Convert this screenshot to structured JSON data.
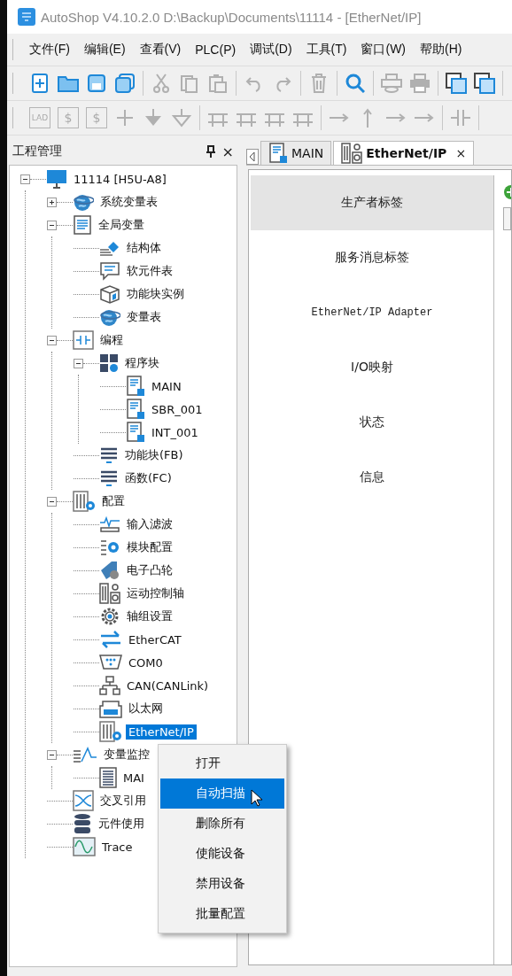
{
  "window": {
    "title": "AutoShop V4.10.2.0  D:\\Backup\\Documents\\11114 - [EtherNet/IP]"
  },
  "menu_bar": [
    "文件(F)",
    "编辑(E)",
    "查看(V)",
    "PLC(P)",
    "调试(D)",
    "工具(T)",
    "窗口(W)",
    "帮助(H)"
  ],
  "toolbar_1": [
    [
      {
        "disabled": false
      },
      {
        "disabled": false
      },
      {
        "disabled": false
      },
      {
        "disabled": false
      }
    ],
    [
      {
        "disabled": true
      },
      {
        "disabled": true
      },
      {
        "disabled": true
      }
    ],
    [
      {
        "disabled": true
      },
      {
        "disabled": true
      }
    ],
    [
      {
        "disabled": true
      }
    ],
    [
      {
        "disabled": false
      }
    ],
    [
      {
        "disabled": true
      },
      {
        "disabled": true
      }
    ],
    [
      {
        "disabled": false
      },
      {
        "disabled": false
      }
    ]
  ],
  "toolbar_2": [
    [
      {
        "label": "LAD",
        "disabled": true
      },
      {
        "label": "$",
        "disabled": true
      },
      {
        "label": "$",
        "disabled": true
      },
      {
        "disabled": true
      },
      {
        "disabled": true
      },
      {
        "disabled": true
      }
    ],
    [
      {
        "disabled": true
      },
      {
        "disabled": true
      },
      {
        "disabled": true
      },
      {
        "disabled": true
      }
    ],
    [
      {
        "disabled": true
      },
      {
        "disabled": true
      },
      {
        "disabled": true
      },
      {
        "disabled": true
      }
    ],
    [
      {
        "disabled": true
      }
    ]
  ],
  "project_panel": {
    "title": "工程管理",
    "close": "×",
    "tree": [
      {
        "label": "11114 [H5U-A8]",
        "expanded": true,
        "selected": false,
        "children": [
          {
            "label": "系统变量表",
            "expanded": false,
            "selected": false
          },
          {
            "label": "全局变量",
            "expanded": true,
            "selected": false,
            "children": [
              {
                "label": "结构体",
                "selected": false
              },
              {
                "label": "软元件表",
                "selected": false
              },
              {
                "label": "功能块实例",
                "selected": false
              },
              {
                "label": "变量表",
                "selected": false
              }
            ]
          },
          {
            "label": "编程",
            "expanded": true,
            "selected": false,
            "children": [
              {
                "label": "程序块",
                "expanded": true,
                "selected": false,
                "children": [
                  {
                    "label": "MAIN",
                    "selected": false
                  },
                  {
                    "label": "SBR_001",
                    "selected": false
                  },
                  {
                    "label": "INT_001",
                    "selected": false
                  }
                ]
              },
              {
                "label": "功能块(FB)",
                "selected": false
              },
              {
                "label": "函数(FC)",
                "selected": false
              }
            ]
          },
          {
            "label": "配置",
            "expanded": true,
            "selected": false,
            "children": [
              {
                "label": "输入滤波",
                "selected": false
              },
              {
                "label": "模块配置",
                "selected": false
              },
              {
                "label": "电子凸轮",
                "selected": false
              },
              {
                "label": "运动控制轴",
                "selected": false
              },
              {
                "label": "轴组设置",
                "selected": false
              },
              {
                "label": "EtherCAT",
                "selected": false
              },
              {
                "label": "COM0",
                "selected": false
              },
              {
                "label": "CAN(CANLink)",
                "selected": false
              },
              {
                "label": "以太网",
                "selected": false
              },
              {
                "label": "EtherNet/IP",
                "selected": true
              }
            ]
          },
          {
            "label": "变量监控",
            "expanded": true,
            "selected": false,
            "children": [
              {
                "label": "MAI",
                "selected": false
              }
            ]
          },
          {
            "label": "交叉引用",
            "selected": false
          },
          {
            "label": "元件使用",
            "selected": false
          },
          {
            "label": "Trace",
            "selected": false
          }
        ]
      }
    ]
  },
  "editor": {
    "tabs": [
      {
        "label": "MAIN",
        "selected": false
      },
      {
        "label": "EtherNet/IP",
        "selected": true,
        "close": "×"
      }
    ],
    "nav": [
      {
        "label": "生产者标签",
        "selected": true
      },
      {
        "label": "服务消息标签",
        "selected": false
      },
      {
        "label": "EtherNet/IP Adapter",
        "selected": false,
        "kind": "mono"
      },
      {
        "label": "I/O映射",
        "selected": false
      },
      {
        "label": "状态",
        "selected": false
      },
      {
        "label": "信息",
        "selected": false
      }
    ]
  },
  "context_menu": [
    {
      "label": "打开",
      "selected": false
    },
    {
      "label": "自动扫描",
      "selected": true
    },
    {
      "label": "删除所有",
      "selected": false
    },
    {
      "label": "使能设备",
      "selected": false
    },
    {
      "label": "禁用设备",
      "selected": false
    },
    {
      "label": "批量配置",
      "selected": false
    }
  ]
}
